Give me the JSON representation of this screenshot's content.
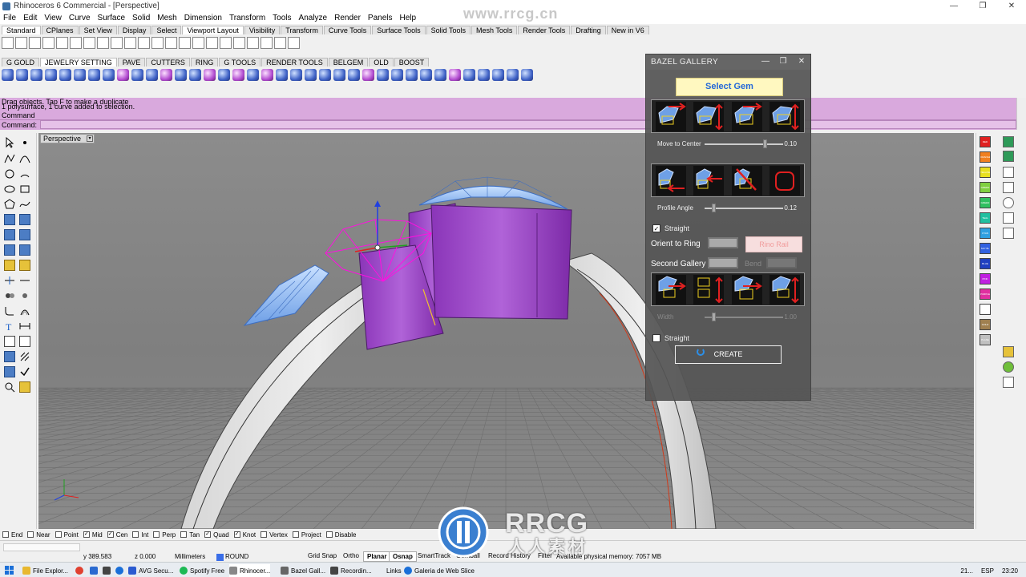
{
  "titlebar": {
    "title": "Rhinoceros 6 Commercial - [Perspective]",
    "min": "—",
    "max": "❐",
    "close": "✕"
  },
  "menus": [
    "File",
    "Edit",
    "View",
    "Curve",
    "Surface",
    "Solid",
    "Mesh",
    "Dimension",
    "Transform",
    "Tools",
    "Analyze",
    "Render",
    "Panels",
    "Help"
  ],
  "tabs1": [
    "Standard",
    "CPlanes",
    "Set View",
    "Display",
    "Select",
    "Viewport Layout",
    "Visibility",
    "Transform",
    "Curve Tools",
    "Surface Tools",
    "Solid Tools",
    "Mesh Tools",
    "Render Tools",
    "Drafting",
    "New in V6"
  ],
  "tabs2": [
    "G GOLD",
    "JEWELRY SETTING",
    "PAVE",
    "CUTTERS",
    "RING",
    "G TOOLS",
    "RENDER TOOLS",
    "BELGEM",
    "OLD",
    "BOOST"
  ],
  "command": {
    "line1": "Drag objects. Tap F to make a duplicate",
    "line2": "1 polysurface, 1 curve added to selection.",
    "line3": "Command",
    "prompt_label": "Command:"
  },
  "viewport": {
    "label": "Perspective",
    "dropdown": "▾"
  },
  "layer_colors": [
    "#e02020",
    "#f08020",
    "#e8e020",
    "#80d040",
    "#30c060",
    "#20c0a0",
    "#30a0e0",
    "#3060e0",
    "#2040c0",
    "#c020e0",
    "#e030a0",
    "#ffffff",
    "#a08050",
    "#c0c0c0"
  ],
  "layer_labels": [
    "RED",
    "ORANGE",
    "YELLOW",
    "GREEN",
    "GREEN",
    "TEAL",
    "CYAN",
    "SKY BL",
    "BLUE",
    "PINK",
    "PURPLE",
    "WHITE",
    "GOLD",
    "PLANE"
  ],
  "gallery": {
    "title": "BAZEL GALLERY",
    "select_gem": "Select Gem",
    "move_to_center": {
      "label": "Move to Center",
      "value": "0.10",
      "level": 0.78
    },
    "profile_angle": {
      "label": "Profile Angle",
      "value": "0.12",
      "level": 0.12
    },
    "straight1": {
      "label": "Straight",
      "checked": "✓"
    },
    "orient_label": "Orient to Ring",
    "rino_rail": "Rino Rail",
    "second_gallery": "Second Gallery",
    "bend": "Bend",
    "width": {
      "label": "Width",
      "value": "1.00",
      "level": 0.12
    },
    "straight2": {
      "label": "Straight",
      "checked": ""
    },
    "create": "CREATE"
  },
  "osnaps": [
    {
      "label": "End",
      "checked": ""
    },
    {
      "label": "Near",
      "checked": ""
    },
    {
      "label": "Point",
      "checked": ""
    },
    {
      "label": "Mid",
      "checked": "✓"
    },
    {
      "label": "Cen",
      "checked": "✓"
    },
    {
      "label": "Int",
      "checked": ""
    },
    {
      "label": "Perp",
      "checked": ""
    },
    {
      "label": "Tan",
      "checked": ""
    },
    {
      "label": "Quad",
      "checked": "✓"
    },
    {
      "label": "Knot",
      "checked": "✓"
    },
    {
      "label": "Vertex",
      "checked": ""
    },
    {
      "label": "Project",
      "checked": ""
    },
    {
      "label": "Disable",
      "checked": ""
    }
  ],
  "status": {
    "y": "y 389.583",
    "z": "z 0.000",
    "units": "Millimeters",
    "layer": "ROUND",
    "grid_snap": "Grid Snap",
    "ortho": "Ortho",
    "planar": "Planar",
    "osnap": "Osnap",
    "smarttrack": "SmartTrack",
    "gumball": "Gumball",
    "record": "Record History",
    "filter": "Filter",
    "memory": "Available physical memory: 7057 MB"
  },
  "taskbar": [
    "File Explor...",
    "AVG Secu...",
    "Spotify Free",
    "Rhinocer...",
    "Bazel Gall...",
    "Recordin...",
    "Links",
    "Galeria de Web Slice"
  ],
  "tray": {
    "temp": "21...",
    "lang": "ESP",
    "time": "23:20"
  },
  "watermark": {
    "site": "www.rrcg.cn",
    "brand": "RRCG",
    "sub": "人人素材"
  }
}
